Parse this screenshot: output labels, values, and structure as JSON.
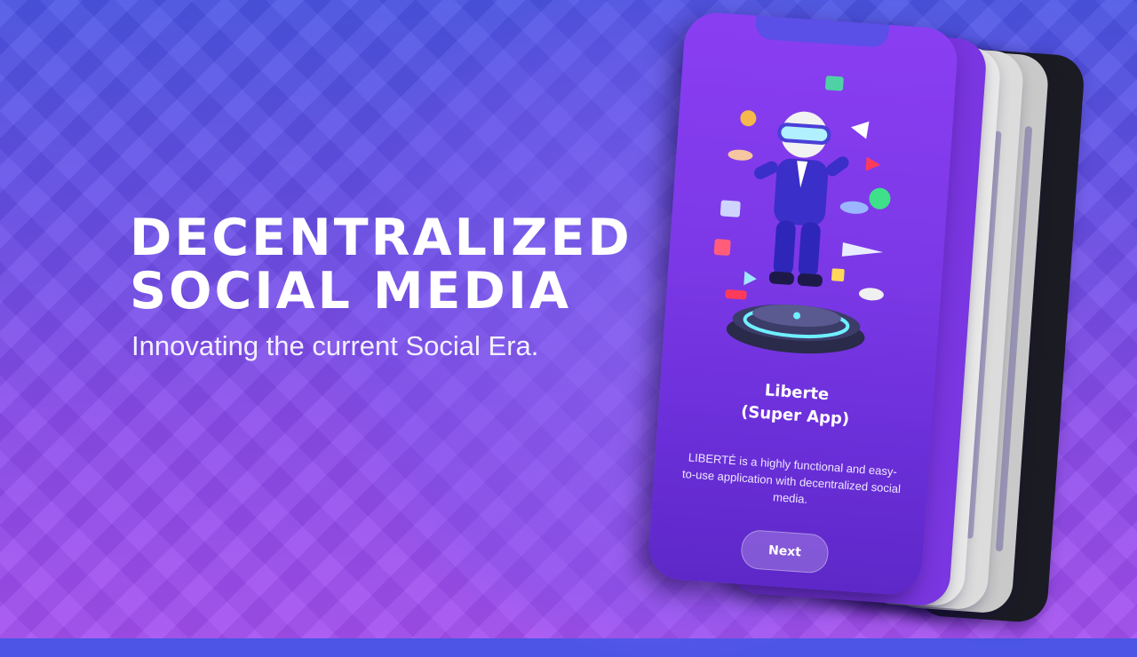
{
  "hero": {
    "headline_line1": "DECENTRALIZED",
    "headline_line2": "SOCIAL MEDIA",
    "tagline": "Innovating the current Social Era."
  },
  "phone_screen": {
    "title_line1": "Liberte",
    "title_line2": "(Super App)",
    "description": "LIBERTÉ is a highly functional and easy-to-use application with decentralized social media.",
    "next_label": "Next",
    "illustration_icon": "vr-avatar-illustration"
  },
  "colors": {
    "background_top": "#4b55e6",
    "background_bottom": "#a44ff0",
    "phone_screen": "#7b38e6",
    "text": "#ffffff"
  }
}
